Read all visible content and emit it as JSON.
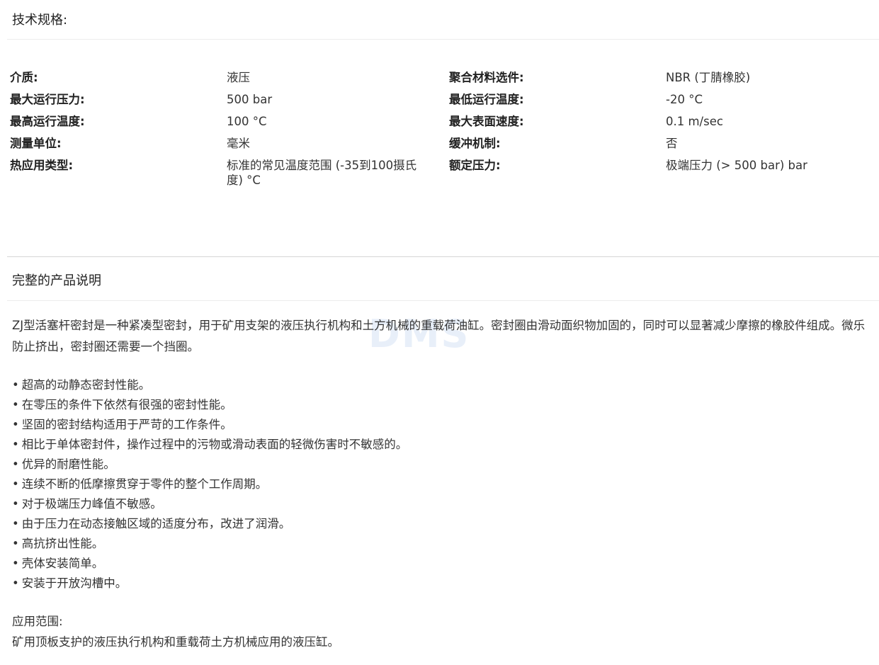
{
  "specs": {
    "title": "技术规格:",
    "rows": [
      {
        "l1": "介质:",
        "v1": "液压",
        "l2": "聚合材料选件:",
        "v2": "NBR (丁腈橡胶)"
      },
      {
        "l1": "最大运行压力:",
        "v1": "500 bar",
        "l2": "最低运行温度:",
        "v2": "-20 °C"
      },
      {
        "l1": "最高运行温度:",
        "v1": "100 °C",
        "l2": "最大表面速度:",
        "v2": "0.1 m/sec"
      },
      {
        "l1": "测量单位:",
        "v1": "毫米",
        "l2": "缓冲机制:",
        "v2": "否"
      },
      {
        "l1": "热应用类型:",
        "v1": "标准的常见温度范围 (-35到100摄氏度) °C",
        "l2": "额定压力:",
        "v2": "极端压力 (> 500 bar) bar"
      }
    ]
  },
  "description": {
    "title": "完整的产品说明",
    "paragraph": "ZJ型活塞杆密封是一种紧凑型密封，用于矿用支架的液压执行机构和土方机械的重载荷油缸。密封圈由滑动面织物加固的，同时可以显著减少摩擦的橡胶件组成。微乐防止挤出，密封圈还需要一个挡圈。",
    "features": [
      "超高的动静态密封性能。",
      "在零压的条件下依然有很强的密封性能。",
      "坚固的密封结构适用于严苛的工作条件。",
      "相比于单体密封件，操作过程中的污物或滑动表面的轻微伤害时不敏感的。",
      "优异的耐磨性能。",
      "连续不断的低摩擦贯穿于零件的整个工作周期。",
      "对于极端压力峰值不敏感。",
      "由于压力在动态接触区域的适度分布，改进了润滑。",
      "高抗挤出性能。",
      "壳体安装简单。",
      "安装于开放沟槽中。"
    ],
    "application_label": "应用范围:",
    "application_text": "矿用顶板支护的液压执行机构和重载荷土方机械应用的液压缸。"
  },
  "watermark": "DMS"
}
